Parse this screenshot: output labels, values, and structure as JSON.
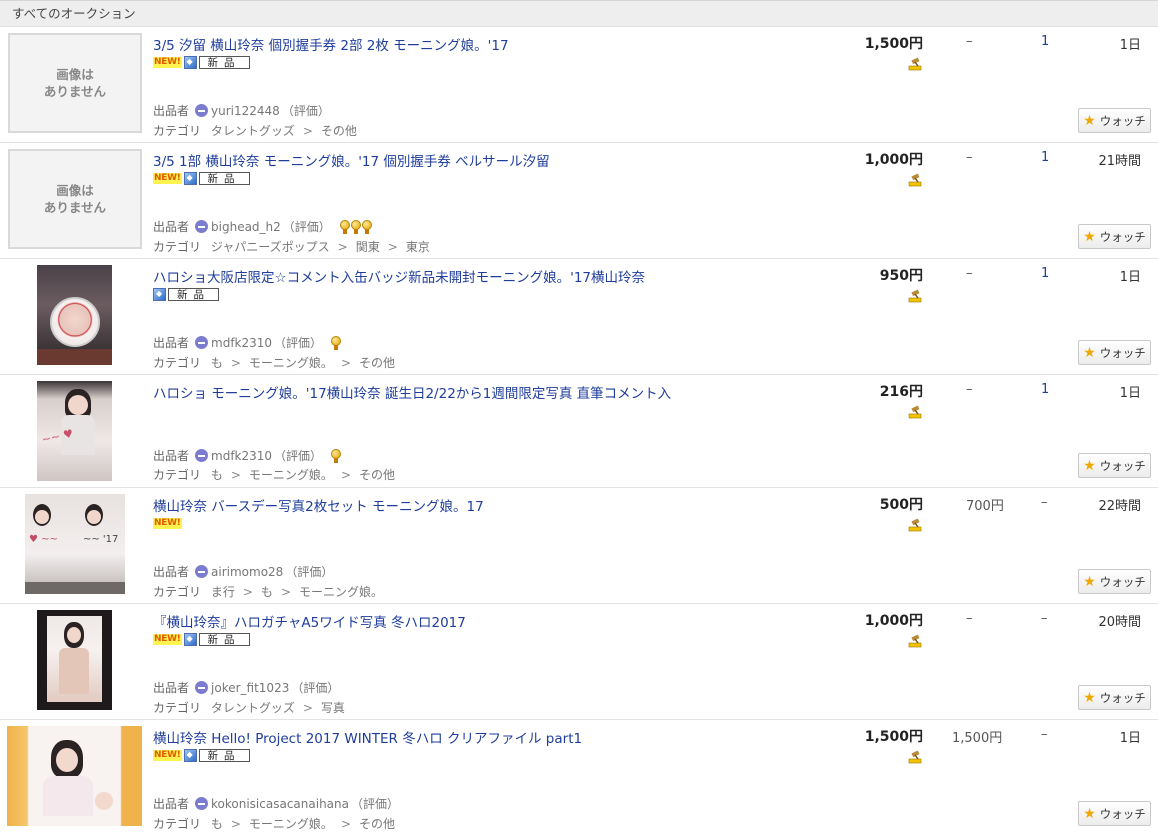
{
  "header": {
    "title": "すべてのオークション"
  },
  "labels": {
    "seller": "出品者",
    "rating": "（評価）",
    "category": "カテゴリ",
    "watch": "ウォッチ",
    "new": "NEW!",
    "brand_new": "新品"
  },
  "items": [
    {
      "title": "3/5 汐留 横山玲奈 個別握手券 2部 2枚 モーニング娘。'17",
      "has_image": false,
      "no_image_text": "画像は\nありません",
      "seller": "yuri122448",
      "medals": 0,
      "category": [
        "タレントグッズ",
        "その他"
      ],
      "price": "1,500円",
      "buynow": "–",
      "bids": "1",
      "time_left": "1日",
      "new": true,
      "brand_new": true
    },
    {
      "title": "3/5 1部 横山玲奈 モーニング娘。'17 個別握手券 ベルサール汐留",
      "has_image": false,
      "no_image_text": "画像は\nありません",
      "seller": "bighead_h2",
      "medals": 3,
      "category": [
        "ジャパニーズポップス",
        "関東",
        "東京"
      ],
      "price": "1,000円",
      "buynow": "–",
      "bids": "1",
      "time_left": "21時間",
      "new": true,
      "brand_new": true
    },
    {
      "title": "ハロショ大阪店限定☆コメント入缶バッジ新品未開封モーニング娘。'17横山玲奈",
      "has_image": true,
      "seller": "mdfk2310",
      "medals": 1,
      "category": [
        "も",
        "モーニング娘。",
        "その他"
      ],
      "price": "950円",
      "buynow": "–",
      "bids": "1",
      "time_left": "1日",
      "new": false,
      "brand_new": true
    },
    {
      "title": "ハロショ モーニング娘。'17横山玲奈 誕生日2/22から1週間限定写真 直筆コメント入",
      "has_image": true,
      "seller": "mdfk2310",
      "medals": 1,
      "category": [
        "も",
        "モーニング娘。",
        "その他"
      ],
      "price": "216円",
      "buynow": "–",
      "bids": "1",
      "time_left": "1日",
      "new": false,
      "brand_new": false
    },
    {
      "title": "横山玲奈 バースデー写真2枚セット モーニング娘。17",
      "has_image": true,
      "seller": "airimomo28",
      "medals": 0,
      "category": [
        "ま行",
        "も",
        "モーニング娘。"
      ],
      "price": "500円",
      "buynow": "700円",
      "bids": "–",
      "time_left": "22時間",
      "new": true,
      "brand_new": false
    },
    {
      "title": "『横山玲奈』ハロガチャA5ワイド写真 冬ハロ2017",
      "has_image": true,
      "seller": "joker_fit1023",
      "medals": 0,
      "category": [
        "タレントグッズ",
        "写真"
      ],
      "price": "1,000円",
      "buynow": "–",
      "bids": "–",
      "time_left": "20時間",
      "new": true,
      "brand_new": true
    },
    {
      "title": "横山玲奈 Hello! Project 2017 WINTER 冬ハロ クリアファイル part1",
      "has_image": true,
      "seller": "kokonisicasacanaihana",
      "medals": 0,
      "category": [
        "も",
        "モーニング娘。",
        "その他"
      ],
      "price": "1,500円",
      "buynow": "1,500円",
      "bids": "–",
      "time_left": "1日",
      "new": true,
      "brand_new": true
    }
  ]
}
